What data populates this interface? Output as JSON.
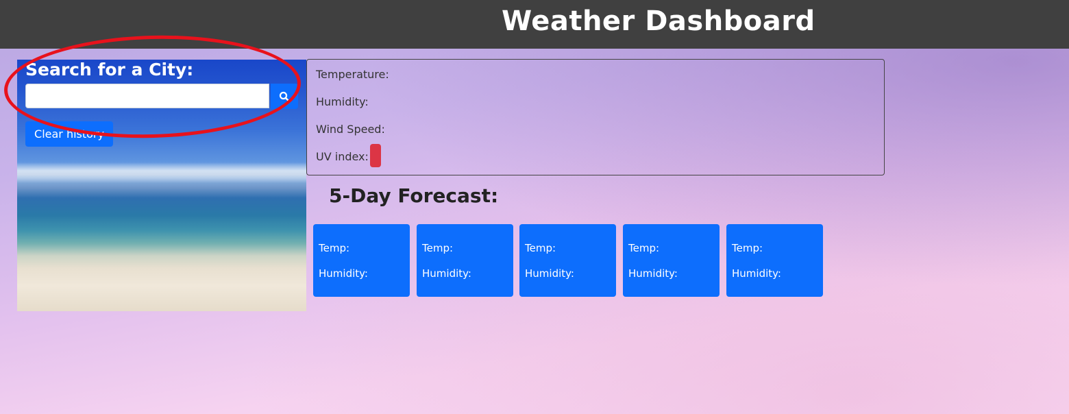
{
  "header": {
    "title": "Weather Dashboard"
  },
  "search": {
    "label": "Search for a City:",
    "input_value": "",
    "placeholder": "",
    "search_icon": "search-icon",
    "clear_label": "Clear history"
  },
  "current": {
    "temperature_label": "Temperature:",
    "humidity_label": "Humidity:",
    "wind_label": "Wind Speed:",
    "uv_label": "UV index:",
    "uv_badge_color": "#dc3545"
  },
  "forecast": {
    "title": "5-Day Forecast:",
    "cards": [
      {
        "temp_label": "Temp:",
        "humidity_label": "Humidity:"
      },
      {
        "temp_label": "Temp:",
        "humidity_label": "Humidity:"
      },
      {
        "temp_label": "Temp:",
        "humidity_label": "Humidity:"
      },
      {
        "temp_label": "Temp:",
        "humidity_label": "Humidity:"
      },
      {
        "temp_label": "Temp:",
        "humidity_label": "Humidity:"
      }
    ]
  },
  "colors": {
    "header_bg": "#404040",
    "accent": "#0d6efd",
    "annotation": "#e8121c"
  }
}
